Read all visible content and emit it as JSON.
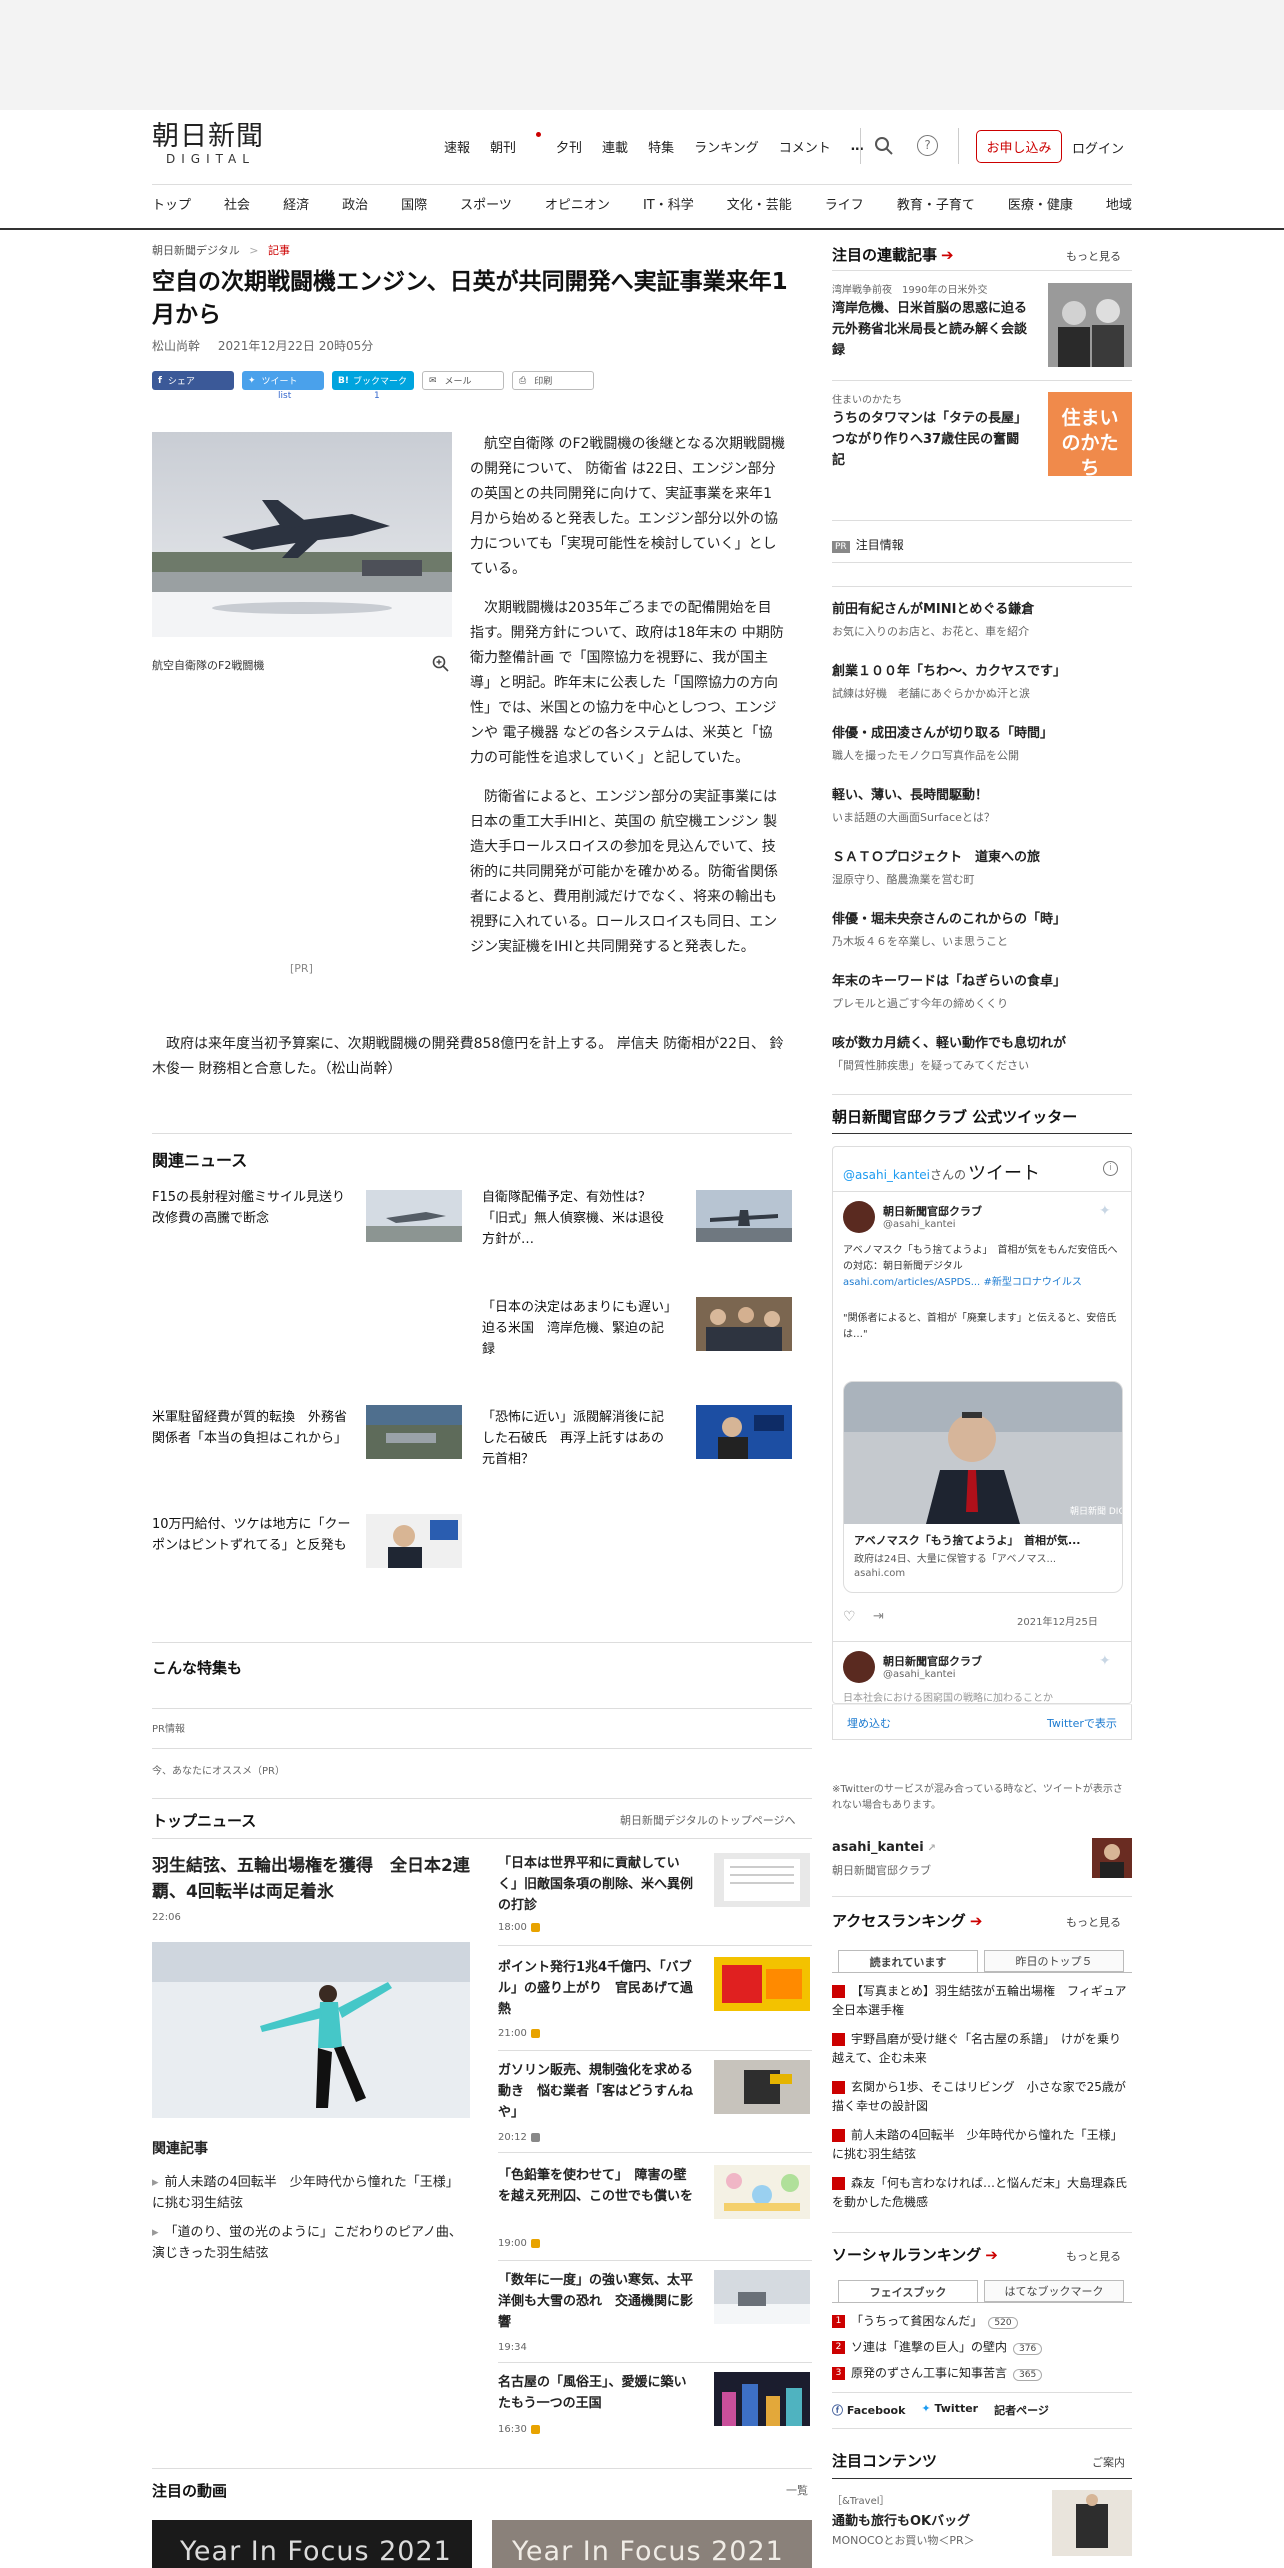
{
  "header": {
    "logo_main": "朝日新聞",
    "logo_sub": "DIGITAL",
    "nav": [
      "速報",
      "朝刊",
      "夕刊",
      "連載",
      "特集",
      "ランキング",
      "コメント"
    ],
    "more": "…",
    "subscribe": "お申し込み",
    "login": "ログイン",
    "categories": [
      "トップ",
      "社会",
      "経済",
      "政治",
      "国際",
      "スポーツ",
      "オピニオン",
      "IT・科学",
      "文化・芸能",
      "ライフ",
      "教育・子育て",
      "医療・健康",
      "地域"
    ]
  },
  "breadcrumb": {
    "root": "朝日新聞デジタル",
    "sep": ">",
    "current": "記事"
  },
  "article": {
    "title": "空自の次期戦闘機エンジン、日英が共同開発へ実証事業来年1月から",
    "author": "松山尚幹",
    "date": "2021年12月22日 20時05分",
    "share": {
      "facebook": "シェア",
      "tweet": "ツイート",
      "tweet_count": "list",
      "hatena": "ブックマーク",
      "hatena_count": "1",
      "mail": "メール",
      "print": "印刷"
    },
    "caption": "航空自衛隊のF2戦闘機",
    "pr": "[PR]",
    "paragraphs": [
      "航空自衛隊 のF2戦闘機の後継となる次期戦闘機の開発について、 防衛省 は22日、エンジン部分の英国との共同開発に向けて、実証事業を来年1月から始めると発表した。エンジン部分以外の協力についても「実現可能性を検討していく」としている。",
      "次期戦闘機は2035年ごろまでの配備開始を目指す。開発方針について、政府は18年末の 中期防衛力整備計画 で「国際協力を視野に、我が国主導」と明記。昨年末に公表した「国際協力の方向性」では、米国との協力を中心としつつ、エンジンや 電子機器 などの各システムは、米英と「協力の可能性を追求していく」と記していた。",
      "防衛省によると、エンジン部分の実証事業には日本の重工大手IHIと、英国の 航空機エンジン 製造大手ロールスロイスの参加を見込んでいて、技術的に共同開発が可能かを確かめる。防衛省関係者によると、費用削減だけでなく、将来の輸出も視野に入れている。ロールスロイスも同日、エンジン実証機をIHIと共同開発すると発表した。",
      "政府は来年度当初予算案に、次期戦闘機の開発費858億円を計上する。 岸信夫 防衛相が22日、 鈴木俊一 財務相と合意した。（松山尚幹）"
    ]
  },
  "related": {
    "heading": "関連ニュース",
    "items": [
      "F15の長射程対艦ミサイル見送り　改修費の高騰で断念",
      "自衛隊配備予定、有効性は？「旧式」無人偵察機、米は退役方針が…",
      "「日本の決定はあまりにも遅い」迫る米国　湾岸危機、緊迫の記録",
      "米軍駐留経費が質的転換　外務省関係者「本当の負担はこれから」",
      "「恐怖に近い」派閥解消後に記した石破氏　再浮上託すはあの元首相？",
      "10万円給付、ツケは地方に「クーポンはピントずれてる」と反発も"
    ]
  },
  "feature": {
    "heading": "こんな特集も",
    "pr_info": "PR情報",
    "recommend": "今、あなたにオススメ（PR）"
  },
  "top_news": {
    "heading": "トップニュース",
    "link": "朝日新聞デジタルのトップページへ",
    "lead_title": "羽生結弦、五輪出場権を獲得　全日本2連覇、4回転半は両足着氷",
    "lead_time": "22:06",
    "related_heading": "関連記事",
    "related": [
      "前人未踏の4回転半　少年時代から憧れた「王様」に挑む羽生結弦",
      "「道のり、蛍の光のように」こだわりのピアノ曲、演じきった羽生結弦"
    ],
    "items": [
      {
        "title": "「日本は世界平和に貢献していく」旧敵国条項の削除、米へ異例の打診",
        "time": "18:00"
      },
      {
        "title": "ポイント発行1兆4千億円、「バブル」の盛り上がり　官民あげて過熱",
        "time": "21:00"
      },
      {
        "title": "ガソリン販売、規制強化を求める動き　悩む業者「客はどうすんねや」",
        "time": "20:12"
      },
      {
        "title": "「色鉛筆を使わせて」　障害の壁を越え死刑囚、この世でも償いを",
        "time": "19:00"
      },
      {
        "title": "「数年に一度」の強い寒気、太平洋側も大雪の恐れ　交通機関に影響",
        "time": "19:34"
      },
      {
        "title": "名古屋の「風俗王」、愛媛に築いたもう一つの王国",
        "time": "16:30"
      }
    ]
  },
  "videos": {
    "heading": "注目の動画",
    "link": "一覧",
    "thumb_text": "Year In Focus 2021"
  },
  "sidebar": {
    "series_heading": "注目の連載記事",
    "more": "もっと見る",
    "series": [
      {
        "tag": "湾岸戦争前夜　1990年の日米外交",
        "title": "湾岸危機、日米首脳の思惑に迫る　元外務省北米局長と読み解く会談録"
      },
      {
        "tag": "住まいのかたち",
        "title": "うちのタワマンは「タテの長屋」　つながり作りへ37歳住民の奮闘記",
        "thumb": "住まいのかたち"
      }
    ],
    "pr_badge": "PR",
    "pr_heading": "注目情報",
    "pr_items": [
      {
        "title": "前田有紀さんがMINIとめぐる鎌倉",
        "sub": "お気に入りのお店と、お花と、車を紹介"
      },
      {
        "title": "創業１００年「ちわ～、カクヤスです」",
        "sub": "試練は好機　老舗にあぐらかかぬ汗と涙"
      },
      {
        "title": "俳優・成田凌さんが切り取る「時間」",
        "sub": "職人を撮ったモノクロ写真作品を公開"
      },
      {
        "title": "軽い、薄い、長時間駆動！",
        "sub": "いま話題の大画面Surfaceとは？"
      },
      {
        "title": "ＳＡＴＯプロジェクト　道東への旅",
        "sub": "湿原守り、酪農漁業を営む町"
      },
      {
        "title": "俳優・堀未央奈さんのこれからの「時」",
        "sub": "乃木坂４６を卒業し、いま思うこと"
      },
      {
        "title": "年末のキーワードは「ねぎらいの食卓」",
        "sub": "プレモルと過ごす今年の締めくくり"
      },
      {
        "title": "咳が数カ月続く、軽い動作でも息切れが",
        "sub": "「間質性肺疾患」を疑ってみてください"
      }
    ],
    "twitter_heading": "朝日新聞官邸クラブ 公式ツイッター",
    "twitter": {
      "handle_link": "@asahi_kantei",
      "handle_suffix": "さんの",
      "tweet_label": "ツイート",
      "name": "朝日新聞官邸クラブ",
      "handle": "@asahi_kantei",
      "text1": "アベノマスク「もう捨てようよ」　首相が気をもんだ安倍氏への対応：朝日新聞デジタル",
      "link": "asahi.com/articles/ASPDS...",
      "hashtag": "#新型コロナウイルス",
      "text2": "\"関係者によると、首相が「廃棄します」と伝えると、安倍氏は…\"",
      "card_title": "アベノマスク「もう捨てようよ」　首相が気...",
      "card_desc": "政府は24日、大量に保管する「アベノマス...",
      "card_domain": "asahi.com",
      "watermark": "朝日新聞 DIGITAL",
      "date": "2021年12月25日",
      "name2": "朝日新聞官邸クラブ",
      "handle2": "@asahi_kantei",
      "preview": "日本社会における困窮国の戦略に加わることか",
      "embed": "埋め込む",
      "view": "Twitterで表示"
    },
    "twitter_note": "※Twitterのサービスが混み合っている時など、ツイートが表示されない場合もあります。",
    "account_name": "asahi_kantei",
    "account_desc": "朝日新聞官邸クラブ",
    "access_heading": "アクセスランキング",
    "access_tabs": [
      "読まれています",
      "昨日のトップ５"
    ],
    "access": [
      "【写真まとめ】羽生結弦が五輪出場権　フィギュア全日本選手権",
      "宇野昌磨が受け継ぐ「名古屋の系譜」　けがを乗り越えて、企む未来",
      "玄関から1歩、そこはリビング　小さな家で25歳が描く幸せの設計図",
      "前人未踏の4回転半　少年時代から憧れた「王様」に挑む羽生結弦",
      "森友「何も言わなければ…と悩んだ末」大島理森氏を動かした危機感"
    ],
    "social_heading": "ソーシャルランキング",
    "social_tabs": [
      "フェイスブック",
      "はてなブックマーク"
    ],
    "social": [
      {
        "title": "「うちって貧困なんだ」",
        "count": "520"
      },
      {
        "title": "ソ連は「進撃の巨人」の壁内",
        "count": "376"
      },
      {
        "title": "原発のずさん工事に知事苦言",
        "count": "365"
      }
    ],
    "social_links": [
      "Facebook",
      "Twitter",
      "記者ページ"
    ],
    "content_heading": "注目コンテンツ",
    "content_link": "ご案内",
    "content_tag": "［&Travel］",
    "content_title": "通勤も旅行もOKバッグ",
    "content_sub": "MONOCOとお買い物＜PR＞"
  }
}
